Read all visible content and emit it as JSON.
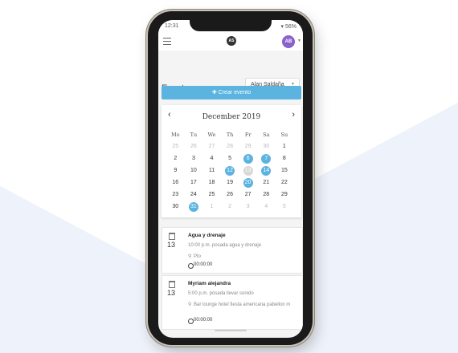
{
  "status": {
    "time": "12:31",
    "right": "▾ 56%"
  },
  "appbar": {
    "logo_text": "AS",
    "avatar_initials": "AB"
  },
  "page": {
    "title": "Eventos",
    "user_select_value": "Alan Saldaña"
  },
  "create_button": {
    "label": "Crear evento",
    "icon": "plus-icon"
  },
  "calendar": {
    "month_label": "December 2019",
    "weekdays": [
      "Mo",
      "Tu",
      "We",
      "Th",
      "Fr",
      "Sa",
      "Su"
    ],
    "weeks": [
      [
        {
          "d": "25",
          "o": true
        },
        {
          "d": "26",
          "o": true
        },
        {
          "d": "27",
          "o": true
        },
        {
          "d": "28",
          "o": true
        },
        {
          "d": "29",
          "o": true
        },
        {
          "d": "30",
          "o": true
        },
        {
          "d": "1"
        }
      ],
      [
        {
          "d": "2"
        },
        {
          "d": "3"
        },
        {
          "d": "4"
        },
        {
          "d": "5"
        },
        {
          "d": "6",
          "e": true
        },
        {
          "d": "7",
          "e": true
        },
        {
          "d": "8"
        }
      ],
      [
        {
          "d": "9"
        },
        {
          "d": "10"
        },
        {
          "d": "11"
        },
        {
          "d": "12",
          "e": true
        },
        {
          "d": "13",
          "t": true
        },
        {
          "d": "14",
          "e": true
        },
        {
          "d": "15"
        }
      ],
      [
        {
          "d": "16"
        },
        {
          "d": "17"
        },
        {
          "d": "18"
        },
        {
          "d": "19"
        },
        {
          "d": "20",
          "e": true
        },
        {
          "d": "21"
        },
        {
          "d": "22"
        }
      ],
      [
        {
          "d": "23"
        },
        {
          "d": "24"
        },
        {
          "d": "25"
        },
        {
          "d": "26"
        },
        {
          "d": "27"
        },
        {
          "d": "28"
        },
        {
          "d": "29"
        }
      ],
      [
        {
          "d": "30"
        },
        {
          "d": "31",
          "e": true
        },
        {
          "d": "1",
          "o": true
        },
        {
          "d": "2",
          "o": true
        },
        {
          "d": "3",
          "o": true
        },
        {
          "d": "4",
          "o": true
        },
        {
          "d": "5",
          "o": true
        }
      ]
    ]
  },
  "events": [
    {
      "day": "13",
      "title": "Agua y drenaje",
      "description": "10:00 p.m. posada agua y drenaje",
      "location": "Pto",
      "duration": "00:00:00"
    },
    {
      "day": "13",
      "title": "Myriam alejandra",
      "description": "5:00 p.m. posada llevar sonido",
      "location": "Bar lounge hotel fiesta americana pabellon m",
      "duration": "00:00:00"
    }
  ]
}
